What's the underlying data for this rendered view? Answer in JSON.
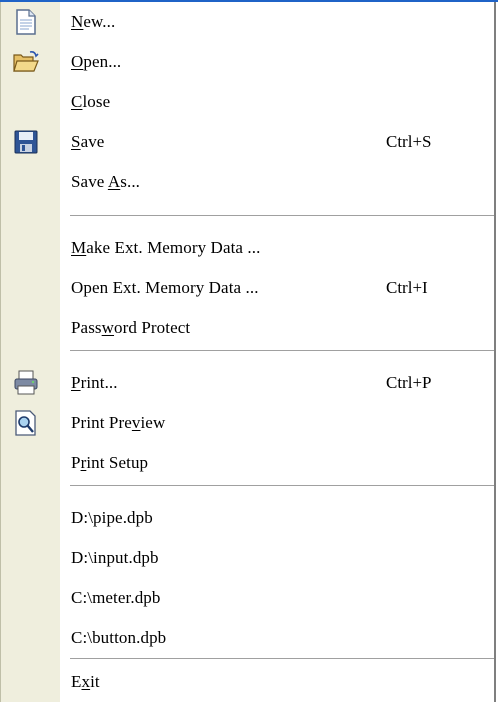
{
  "menu": {
    "items": [
      {
        "label": "New...",
        "mnemonic_index": 0,
        "shortcut": "",
        "icon": "new-document-icon"
      },
      {
        "label": "Open...",
        "mnemonic_index": 0,
        "shortcut": "",
        "icon": "open-folder-icon"
      },
      {
        "label": "Close",
        "mnemonic_index": 0,
        "shortcut": "",
        "icon": ""
      },
      {
        "label": "Save",
        "mnemonic_index": 0,
        "shortcut": "Ctrl+S",
        "icon": "save-disk-icon"
      },
      {
        "label": "Save As...",
        "mnemonic_index": 5,
        "shortcut": "",
        "icon": ""
      },
      {
        "label": "Make Ext. Memory Data ...",
        "mnemonic_index": 0,
        "shortcut": "",
        "icon": ""
      },
      {
        "label": "Open Ext. Memory Data ...",
        "mnemonic_index": -1,
        "shortcut": "Ctrl+I",
        "icon": ""
      },
      {
        "label": "Password Protect",
        "mnemonic_index": 4,
        "shortcut": "",
        "icon": ""
      },
      {
        "label": "Print...",
        "mnemonic_index": 0,
        "shortcut": "Ctrl+P",
        "icon": "printer-icon"
      },
      {
        "label": "Print Preview",
        "mnemonic_index": 9,
        "shortcut": "",
        "icon": "print-preview-icon"
      },
      {
        "label": "Print Setup",
        "mnemonic_index": 1,
        "shortcut": "",
        "icon": ""
      },
      {
        "label": "D:\\pipe.dpb",
        "mnemonic_index": -1,
        "shortcut": "",
        "icon": ""
      },
      {
        "label": "D:\\input.dpb",
        "mnemonic_index": -1,
        "shortcut": "",
        "icon": ""
      },
      {
        "label": "C:\\meter.dpb",
        "mnemonic_index": -1,
        "shortcut": "",
        "icon": ""
      },
      {
        "label": "C:\\button.dpb",
        "mnemonic_index": -1,
        "shortcut": "",
        "icon": ""
      },
      {
        "label": "Exit",
        "mnemonic_index": 1,
        "shortcut": "",
        "icon": ""
      }
    ]
  },
  "colors": {
    "gutter": "#efeedd",
    "highlight_line": "#1f63c7"
  }
}
